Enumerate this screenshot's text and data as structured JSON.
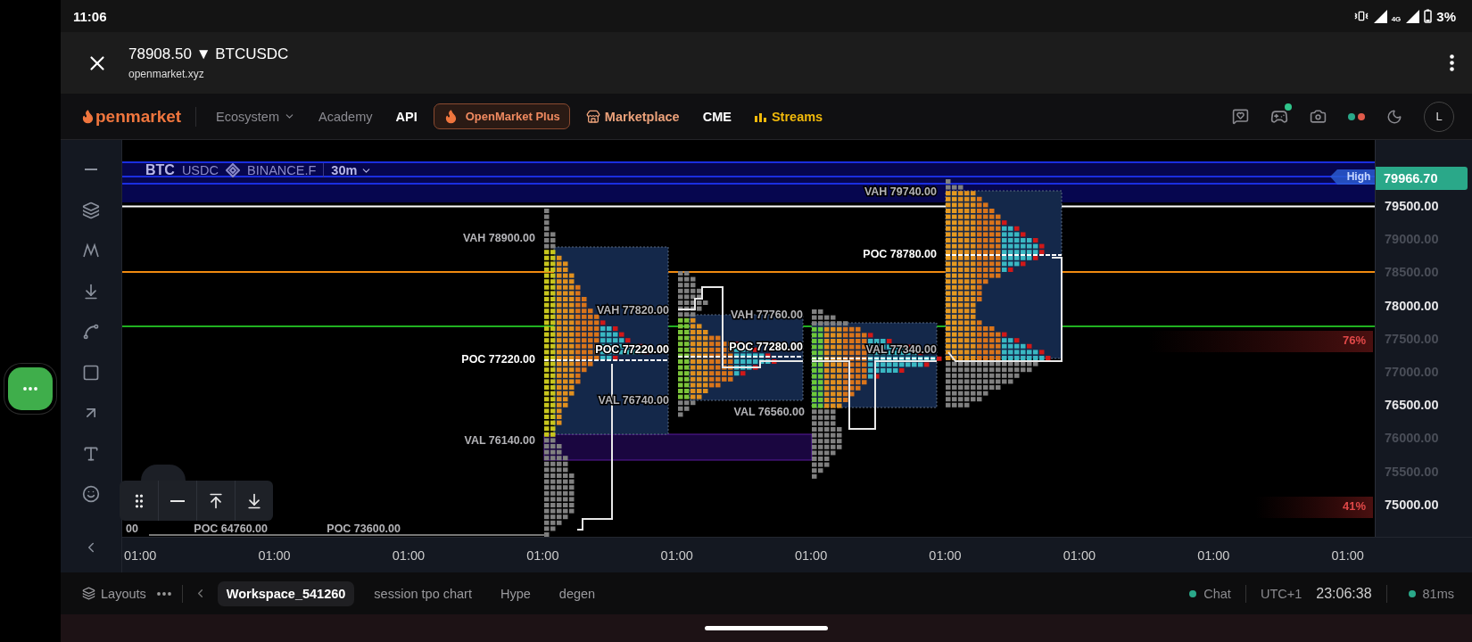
{
  "status_bar": {
    "time": "11:06",
    "network": "4G",
    "battery": "3%"
  },
  "browser": {
    "title": "78908.50 ▼ BTCUSDC",
    "url": "openmarket.xyz"
  },
  "nav": {
    "logo": "penmarket",
    "items": [
      {
        "label": "Ecosystem",
        "kind": "dropdown"
      },
      {
        "label": "Academy",
        "kind": "muted"
      },
      {
        "label": "API",
        "kind": "plain"
      },
      {
        "label": "OpenMarket Plus",
        "kind": "promo"
      },
      {
        "label": "Marketplace",
        "kind": "store"
      },
      {
        "label": "CME",
        "kind": "plain"
      },
      {
        "label": "Streams",
        "kind": "streams"
      }
    ],
    "avatar": "L"
  },
  "chart": {
    "symbol": "BTC",
    "quote": "USDC",
    "exchange": "BINANCE.F",
    "interval": "30m",
    "last_price": "79966.70",
    "high_tag": "High",
    "price_axis": [
      {
        "label": "79500.00",
        "bright": true
      },
      {
        "label": "79000.00",
        "bright": false
      },
      {
        "label": "78500.00",
        "bright": false
      },
      {
        "label": "78000.00",
        "bright": true
      },
      {
        "label": "77500.00",
        "bright": false
      },
      {
        "label": "77000.00",
        "bright": false
      },
      {
        "label": "76500.00",
        "bright": true
      },
      {
        "label": "76000.00",
        "bright": false
      },
      {
        "label": "75500.00",
        "bright": false
      },
      {
        "label": "75000.00",
        "bright": true
      }
    ],
    "time_axis": [
      "01:00",
      "01:00",
      "01:00",
      "01:00",
      "01:00",
      "01:00",
      "01:00",
      "01:00",
      "01:00",
      "01:00"
    ],
    "profile_labels": [
      {
        "label": "VAH 78900.00",
        "kind": "vah"
      },
      {
        "label": "POC 77220.00",
        "kind": "poc"
      },
      {
        "label": "VAL 76140.00",
        "kind": "val"
      },
      {
        "label": "VAH 77820.00",
        "kind": "vah"
      },
      {
        "label": "POC 77220.00",
        "kind": "poc"
      },
      {
        "label": "VAL 76740.00",
        "kind": "val"
      },
      {
        "label": "VAH 77760.00",
        "kind": "vah"
      },
      {
        "label": "POC 77280.00",
        "kind": "poc"
      },
      {
        "label": "VAL 76560.00",
        "kind": "val"
      },
      {
        "label": "VAH 79740.00",
        "kind": "vah"
      },
      {
        "label": "POC 78780.00",
        "kind": "poc"
      },
      {
        "label": "VAL 77340.00",
        "kind": "val"
      },
      {
        "label": "00",
        "kind": "val"
      },
      {
        "label": "POC 64760.00",
        "kind": "val"
      },
      {
        "label": "POC 73600.00",
        "kind": "val"
      }
    ],
    "percent_tags": [
      "76%",
      "41%"
    ]
  },
  "bottom_bar": {
    "layouts": "Layouts",
    "tabs": [
      {
        "label": "Workspace_541260",
        "selected": true
      },
      {
        "label": "session tpo chart",
        "selected": false
      },
      {
        "label": "Hype",
        "selected": false
      },
      {
        "label": "degen",
        "selected": false
      }
    ],
    "chat": "Chat",
    "timezone": "UTC+1",
    "clock": "23:06:38",
    "latency": "81ms"
  }
}
